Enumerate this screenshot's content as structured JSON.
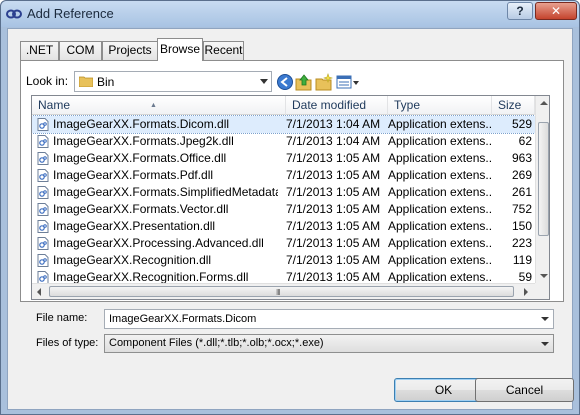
{
  "window": {
    "title": "Add Reference",
    "help": "?",
    "close": "✕"
  },
  "tabs": [
    {
      "label": ".NET"
    },
    {
      "label": "COM"
    },
    {
      "label": "Projects"
    },
    {
      "label": "Browse",
      "active": true
    },
    {
      "label": "Recent"
    }
  ],
  "lookin": {
    "label": "Look in:",
    "value": "Bin"
  },
  "toolbar": {
    "icons": [
      "back-icon",
      "up-folder-icon",
      "new-folder-icon",
      "view-menu-icon"
    ]
  },
  "columns": {
    "name": "Name",
    "date": "Date modified",
    "type": "Type",
    "size": "Size"
  },
  "files": [
    {
      "name": "ImageGearXX.Formats.Dicom.dll",
      "date": "7/1/2013 1:04 AM",
      "type": "Application extens...",
      "size": "529",
      "selected": true
    },
    {
      "name": "ImageGearXX.Formats.Jpeg2k.dll",
      "date": "7/1/2013 1:04 AM",
      "type": "Application extens...",
      "size": "62"
    },
    {
      "name": "ImageGearXX.Formats.Office.dll",
      "date": "7/1/2013 1:05 AM",
      "type": "Application extens...",
      "size": "963"
    },
    {
      "name": "ImageGearXX.Formats.Pdf.dll",
      "date": "7/1/2013 1:05 AM",
      "type": "Application extens...",
      "size": "269"
    },
    {
      "name": "ImageGearXX.Formats.SimplifiedMetadata.dll",
      "date": "7/1/2013 1:05 AM",
      "type": "Application extens...",
      "size": "261"
    },
    {
      "name": "ImageGearXX.Formats.Vector.dll",
      "date": "7/1/2013 1:05 AM",
      "type": "Application extens...",
      "size": "752"
    },
    {
      "name": "ImageGearXX.Presentation.dll",
      "date": "7/1/2013 1:05 AM",
      "type": "Application extens...",
      "size": "150"
    },
    {
      "name": "ImageGearXX.Processing.Advanced.dll",
      "date": "7/1/2013 1:05 AM",
      "type": "Application extens...",
      "size": "223"
    },
    {
      "name": "ImageGearXX.Recognition.dll",
      "date": "7/1/2013 1:05 AM",
      "type": "Application extens...",
      "size": "119"
    },
    {
      "name": "ImageGearXX.Recognition.Forms.dll",
      "date": "7/1/2013 1:05 AM",
      "type": "Application extens...",
      "size": "59"
    }
  ],
  "filename": {
    "label": "File name:",
    "value": "ImageGearXX.Formats.Dicom"
  },
  "filetype": {
    "label": "Files of type:",
    "value": "Component Files (*.dll;*.tlb;*.olb;*.ocx;*.exe)"
  },
  "buttons": {
    "ok": "OK",
    "cancel": "Cancel"
  },
  "colors": {
    "title_bar": "#a8c3e3",
    "close": "#c4432d",
    "selection": "#ddecfd",
    "folder": "#e8c15a"
  }
}
